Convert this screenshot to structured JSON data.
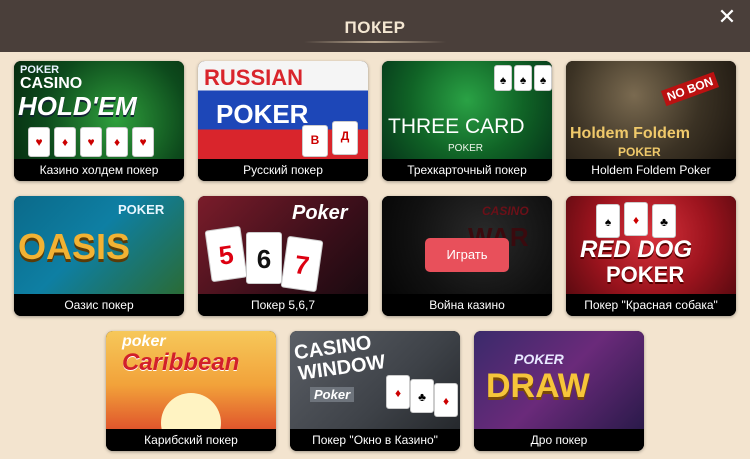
{
  "header": {
    "title": "ПОКЕР",
    "close_icon": "close-icon"
  },
  "colors": {
    "header_bg": "#4a3f3a",
    "page_bg": "#f3e4cf",
    "play_button": "#e8505b"
  },
  "games": [
    {
      "caption": "Казино холдем покер",
      "art": {
        "line1": "POKER",
        "line2": "CASINO",
        "line3": "HOLD'EM"
      }
    },
    {
      "caption": "Русский покер",
      "art": {
        "line1": "RUSSIAN",
        "line2": "POKER",
        "cards": [
          "В",
          "Д"
        ]
      }
    },
    {
      "caption": "Трехкарточный покер",
      "art": {
        "line1": "THREE CARD",
        "line2": "POKER"
      }
    },
    {
      "caption": "Holdem Foldem Poker",
      "art": {
        "badge": "NO BON",
        "line1": "Holdem Foldem",
        "line2": "POKER"
      }
    },
    {
      "caption": "Оазис покер",
      "art": {
        "line1": "POKER",
        "line2": "OASIS"
      }
    },
    {
      "caption": "Покер 5,6,7",
      "art": {
        "line1": "Poker",
        "cards": [
          "5",
          "6",
          "7"
        ]
      }
    },
    {
      "caption": "Война казино",
      "art": {
        "line1": "CASINO",
        "line2": "WAR"
      },
      "play_label": "Играть"
    },
    {
      "caption": "Покер \"Красная собака\"",
      "art": {
        "line1": "RED DOG",
        "line2": "POKER"
      }
    },
    {
      "caption": "Карибский покер",
      "art": {
        "line1": "poker",
        "line2": "Caribbean"
      }
    },
    {
      "caption": "Покер \"Окно в Казино\"",
      "art": {
        "line1": "CASINO",
        "line2": "WINDOW",
        "line3": "Poker"
      }
    },
    {
      "caption": "Дро покер",
      "art": {
        "line1": "POKER",
        "line2": "DRAW"
      }
    }
  ]
}
